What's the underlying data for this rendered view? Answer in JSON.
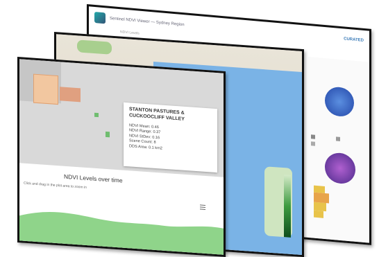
{
  "back_window": {
    "title": "Sentinel NDVI Viewer — Sydney Region",
    "brand": "CURATED",
    "sub": "NDVI Levels"
  },
  "front_window": {
    "popup": {
      "heading": "STANTON PASTURES & CUCKOOCLIFF VALLEY",
      "lines": [
        "NDVI Mean: 0.46",
        "NDVI Range: 0.37",
        "NDVI StDev: 0.16",
        "Scene Count: 8",
        "DDS Area: 0.1 km2"
      ]
    },
    "chart": {
      "title": "NDVI Levels over time",
      "instruction": "Click and drag in the plot area to zoom in"
    }
  },
  "colors": {
    "water": "#7ab3e6",
    "vegetation": "#a8cf8e",
    "chart_fill": "#8fd48a"
  }
}
